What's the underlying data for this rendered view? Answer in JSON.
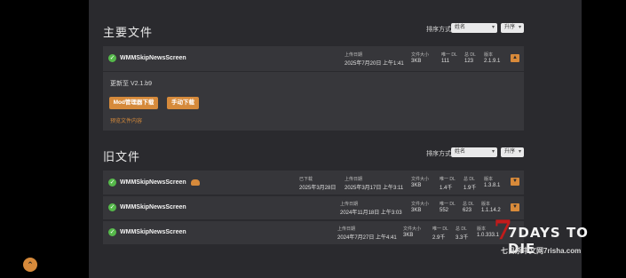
{
  "main_section": {
    "title": "主要文件",
    "sort_label": "排序方式",
    "sort_value": "姓名",
    "order_value": "升序",
    "file": {
      "name": "WMMSkipNewsScreen",
      "upload_label": "上传日期",
      "upload_value": "2025年7月20日 上午1:41",
      "size_label": "文件大小",
      "size_value": "3KB",
      "unique_label": "唯一 DL",
      "unique_value": "111",
      "total_label": "总 DL",
      "total_value": "123",
      "version_label": "版本",
      "version_value": "2.1.9.1"
    },
    "expanded": {
      "updated_to": "更新至 V2.1.b9",
      "mod_manager_btn": "Mod管理器下载",
      "manual_btn": "手动下载",
      "preview_link": "预览文件内容"
    }
  },
  "old_section": {
    "title": "旧文件",
    "sort_label": "排序方式",
    "sort_value": "姓名",
    "order_value": "升序",
    "files": [
      {
        "name": "WMMSkipNewsScreen",
        "extra_label": "已下载",
        "extra_value": "2025年3月28日",
        "upload_label": "上传日期",
        "upload_value": "2025年3月17日 上午3:11",
        "size_label": "文件大小",
        "size_value": "3KB",
        "unique_label": "唯一 DL",
        "unique_value": "1.4千",
        "total_label": "总 DL",
        "total_value": "1.9千",
        "version_label": "版本",
        "version_value": "1.3.8.1"
      },
      {
        "name": "WMMSkipNewsScreen",
        "upload_label": "上传日期",
        "upload_value": "2024年11月18日 上午3:03",
        "size_label": "文件大小",
        "size_value": "3KB",
        "unique_label": "唯一 DL",
        "unique_value": "552",
        "total_label": "总 DL",
        "total_value": "623",
        "version_label": "版本",
        "version_value": "1.1.14.2"
      },
      {
        "name": "WMMSkipNewsScreen",
        "upload_label": "上传日期",
        "upload_value": "2024年7月27日 上午4:41",
        "size_label": "文件大小",
        "size_value": "3KB",
        "unique_label": "唯一 DL",
        "unique_value": "2.9千",
        "total_label": "总 DL",
        "total_value": "3.3千",
        "version_label": "版本",
        "version_value": "1.0.333.1"
      }
    ]
  },
  "watermark": {
    "title": "7DAYS TO DIE",
    "subtitle": "七日杀中文网7risha.com"
  },
  "icons": {
    "check": "check-circle-icon",
    "toggle": "chevron-icon",
    "cloud": "cloud-download-icon",
    "back_to_top": "arrow-up-icon"
  },
  "colors": {
    "accent": "#d68a3b",
    "success": "#55b84a",
    "panel": "#2a2a2e",
    "row": "#36363a"
  }
}
